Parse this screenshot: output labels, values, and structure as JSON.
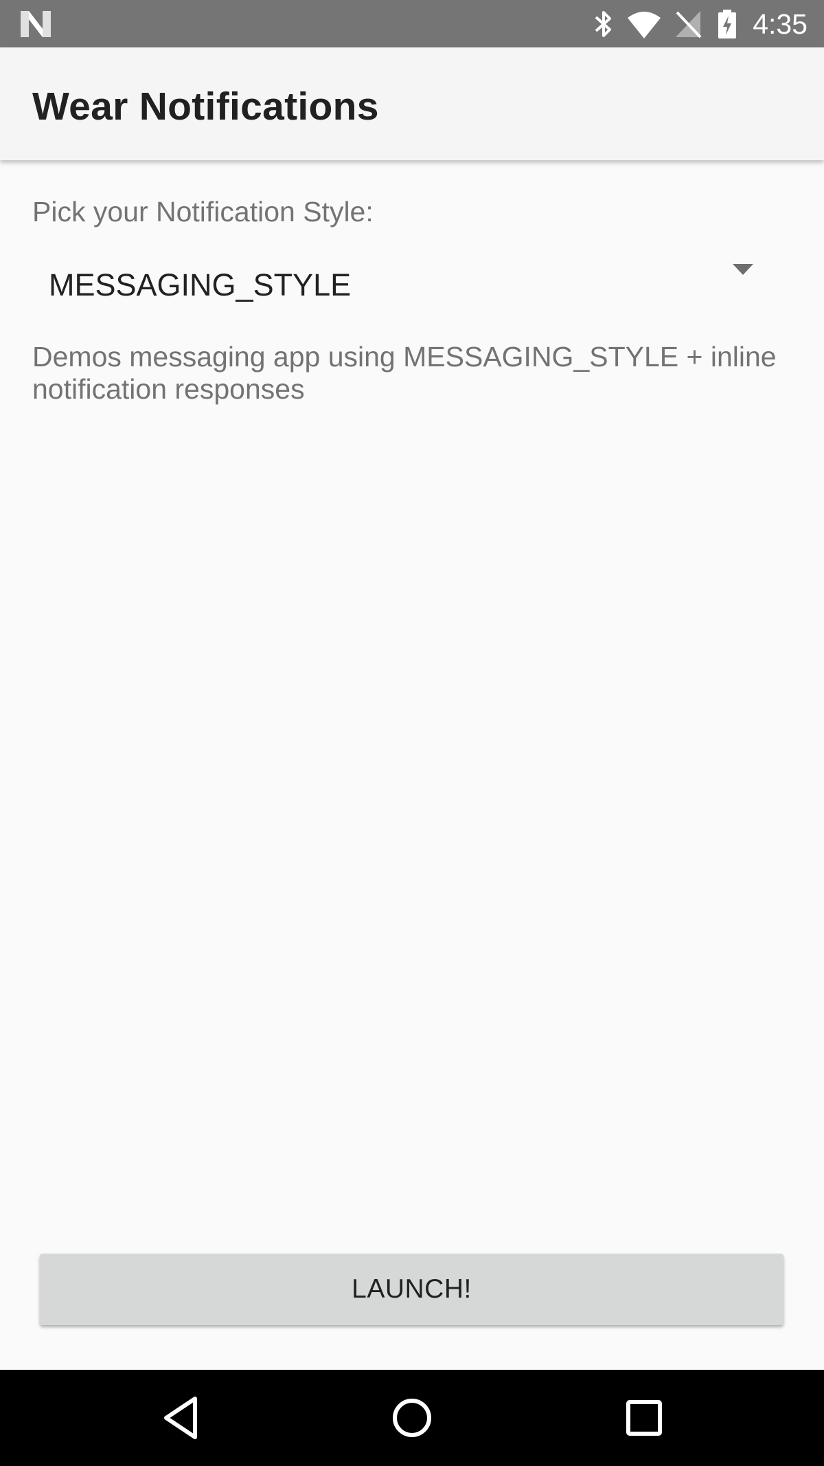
{
  "status_bar": {
    "time": "4:35",
    "icons": [
      "n-logo-icon",
      "bluetooth-icon",
      "wifi-icon",
      "no-signal-icon",
      "battery-charging-icon"
    ]
  },
  "app_bar": {
    "title": "Wear Notifications"
  },
  "main": {
    "pick_label": "Pick your Notification Style:",
    "selected_style": "MESSAGING_STYLE",
    "description": "Demos messaging app using MESSAGING_STYLE + inline notification responses",
    "launch_label": "LAUNCH!"
  },
  "nav_bar": {
    "icons": [
      "back-icon",
      "home-icon",
      "recents-icon"
    ]
  },
  "colors": {
    "status_bar": "#757575",
    "app_bar": "#f5f5f5",
    "background": "#fafafa",
    "button": "#d6d7d7",
    "nav_bar": "#000000"
  }
}
